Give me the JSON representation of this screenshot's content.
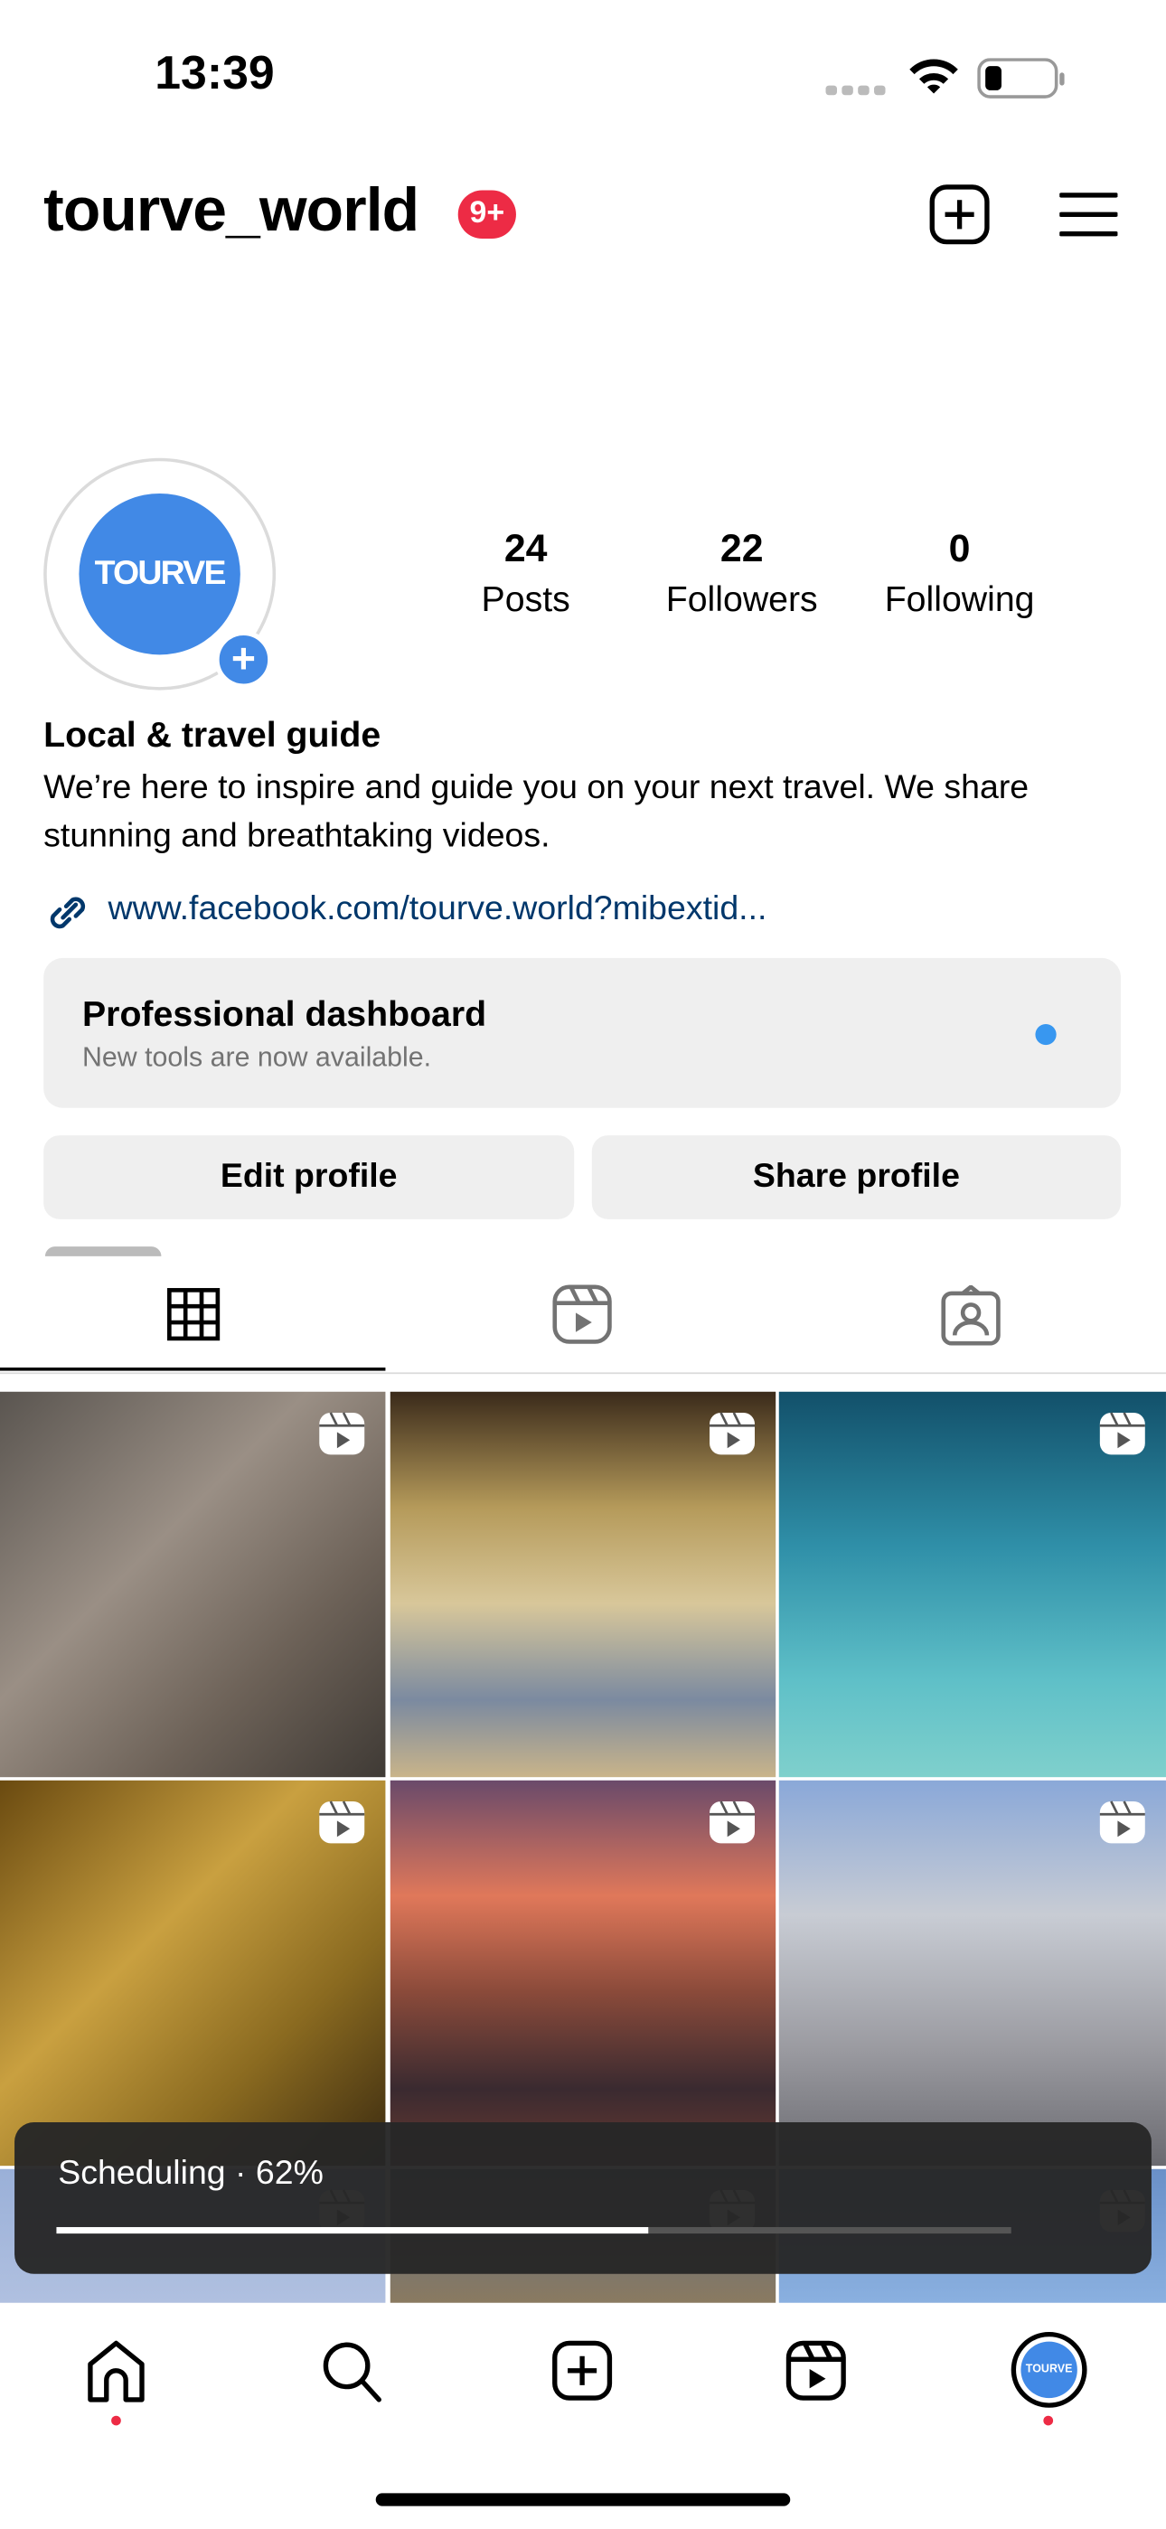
{
  "status_bar": {
    "time": "13:39"
  },
  "header": {
    "username": "tourve_world",
    "notification_badge": "9+",
    "icons": [
      "new-post-icon",
      "menu-icon"
    ]
  },
  "profile": {
    "avatar_text": "TOURVE",
    "stats": [
      {
        "value": "24",
        "label": "Posts"
      },
      {
        "value": "22",
        "label": "Followers"
      },
      {
        "value": "0",
        "label": "Following"
      }
    ],
    "category": "Local & travel guide",
    "bio": "We’re here to inspire and guide you on your next travel. We share stunning and breathtaking videos.",
    "link": "www.facebook.com/tourve.world?mibextid..."
  },
  "dashboard": {
    "title": "Professional dashboard",
    "subtitle": "New tools are now available."
  },
  "buttons": {
    "edit": "Edit profile",
    "share": "Share profile"
  },
  "tabs": [
    {
      "icon": "grid-icon",
      "active": true
    },
    {
      "icon": "reels-icon",
      "active": false
    },
    {
      "icon": "tagged-icon",
      "active": false
    }
  ],
  "upload": {
    "label": "Scheduling · 62%",
    "progress": 62
  },
  "nav": [
    {
      "icon": "home-icon",
      "dot": true
    },
    {
      "icon": "search-icon",
      "dot": false
    },
    {
      "icon": "create-icon",
      "dot": false
    },
    {
      "icon": "reels-icon",
      "dot": false
    },
    {
      "icon": "profile-avatar",
      "dot": true
    }
  ],
  "colors": {
    "accent": "#3897f0",
    "badge": "#ed2b45",
    "link": "#00376b",
    "avatar_blue": "#4189e6"
  }
}
